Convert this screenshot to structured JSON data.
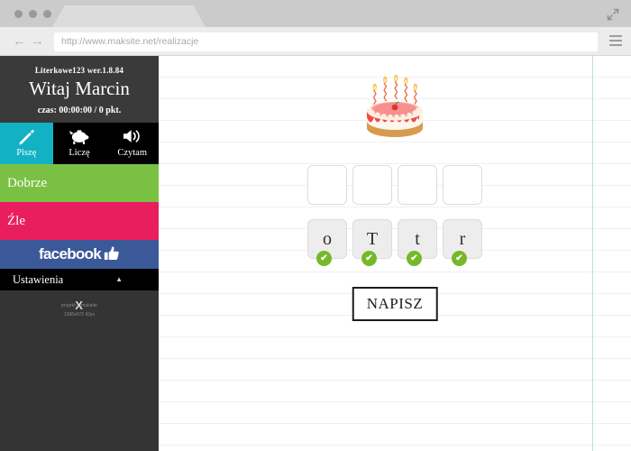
{
  "browser": {
    "tab_title": "",
    "url": "http://www.maksite.net/realizacje",
    "back_glyph": "←",
    "forward_glyph": "→",
    "expand_icon_name": "expand-icon",
    "menu_icon_name": "hamburger-menu-icon"
  },
  "sidebar": {
    "app_version": "Literkowe123 wer.1.8.84",
    "greeting": "Witaj Marcin",
    "score_line": "czas: 00:00:00 / 0 pkt.",
    "nav": [
      {
        "label": "Piszę",
        "icon": "pencil-icon",
        "glyph": "✎",
        "active": true
      },
      {
        "label": "Liczę",
        "icon": "piggy-bank-icon",
        "glyph": "🐷",
        "active": false
      },
      {
        "label": "Czytam",
        "icon": "speaker-icon",
        "glyph": "🔊",
        "active": false
      }
    ],
    "status_good": "Dobrze",
    "status_bad": "Źle",
    "facebook_label": "facebook",
    "facebook_icon": "thumbs-up-icon",
    "settings_label": "Ustawienia",
    "settings_chevron": "▲",
    "credit_prefix": "projekt:",
    "credit_name": "maksite",
    "credit_x": "X",
    "credit_resolution": "1366x672 42px"
  },
  "main": {
    "image_alt": "birthday-cake",
    "slots": [
      "",
      "",
      "",
      ""
    ],
    "tiles": [
      {
        "letter": "o",
        "correct": true
      },
      {
        "letter": "T",
        "correct": true
      },
      {
        "letter": "t",
        "correct": true
      },
      {
        "letter": "r",
        "correct": true
      }
    ],
    "check_glyph": "✔",
    "write_button": "NAPISZ"
  },
  "colors": {
    "accent_teal": "#13b1c4",
    "good_green": "#7ac143",
    "bad_pink": "#e91e5e",
    "facebook_blue": "#3b5998",
    "check_green": "#76b82a",
    "margin_line": "#b9dce4",
    "sidebar_dark": "#343434"
  }
}
